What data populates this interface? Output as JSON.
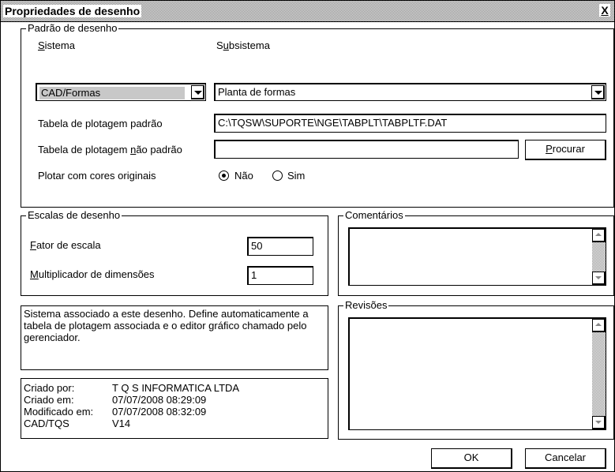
{
  "dialog": {
    "title": "Propriedades de desenho",
    "close_label": "X"
  },
  "padrao": {
    "legend": "Padrão de desenho",
    "sistema_label_pre": "",
    "sistema_label_u": "S",
    "sistema_label_post": "istema",
    "sistema_value": "CAD/Formas",
    "subsistema_label_pre": "S",
    "subsistema_label_u": "u",
    "subsistema_label_post": "bsistema",
    "subsistema_value": "Planta de formas",
    "tabela_padrao_label": "Tabela de plotagem padrão",
    "tabela_padrao_value": "C:\\TQSW\\SUPORTE\\NGE\\TABPLT\\TABPLTF.DAT",
    "tabela_nao_padrao_pre": "Tabela de plotagem ",
    "tabela_nao_padrao_u": "n",
    "tabela_nao_padrao_post": "ão padrão",
    "tabela_nao_padrao_value": "",
    "procurar_u": "P",
    "procurar_rest": "rocurar",
    "cores_label": "Plotar com cores originais",
    "radio_nao": "Não",
    "radio_sim": "Sim",
    "cores_selected": "Não"
  },
  "escalas": {
    "legend": "Escalas de desenho",
    "fator_u": "F",
    "fator_rest": "ator de escala",
    "fator_value": "50",
    "mult_u": "M",
    "mult_rest": "ultiplicador de dimensões",
    "mult_value": "1"
  },
  "comentarios": {
    "legend": "Comentários"
  },
  "revisoes": {
    "legend": "Revisões"
  },
  "description": "Sistema associado a este desenho. Define automaticamente a tabela de plotagem associada e o editor gráfico chamado pelo gerenciador.",
  "info": [
    {
      "key": "Criado por:",
      "value": "T Q S  INFORMATICA LTDA"
    },
    {
      "key": "Criado em:",
      "value": "07/07/2008 08:29:09"
    },
    {
      "key": "Modificado em:",
      "value": "07/07/2008 08:32:09"
    },
    {
      "key": "CAD/TQS",
      "value": "V14"
    }
  ],
  "buttons": {
    "ok": "OK",
    "cancel": "Cancelar"
  }
}
